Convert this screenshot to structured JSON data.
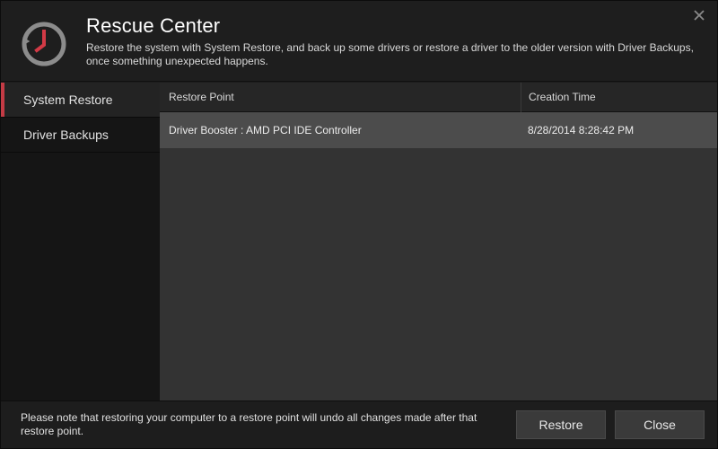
{
  "header": {
    "title": "Rescue Center",
    "subtitle": "Restore the system with System Restore, and back up some drivers or restore a driver to the older version with Driver Backups, once something unexpected happens.",
    "logo_icon": "clock-rewind-icon",
    "close_icon": "close-icon"
  },
  "sidebar": {
    "items": [
      {
        "label": "System Restore",
        "active": true
      },
      {
        "label": "Driver Backups",
        "active": false
      }
    ]
  },
  "table": {
    "columns": [
      "Restore Point",
      "Creation Time"
    ],
    "rows": [
      {
        "restore_point": "Driver Booster : AMD PCI IDE Controller",
        "creation_time": "8/28/2014 8:28:42 PM"
      }
    ]
  },
  "footer": {
    "note": "Please note that restoring your computer to a restore point will undo all changes made after that restore point.",
    "restore_label": "Restore",
    "close_label": "Close"
  },
  "colors": {
    "accent": "#c43b45",
    "background": "#1d1d1d",
    "content_bg": "#333333",
    "selected_row": "#4c4c4c"
  }
}
